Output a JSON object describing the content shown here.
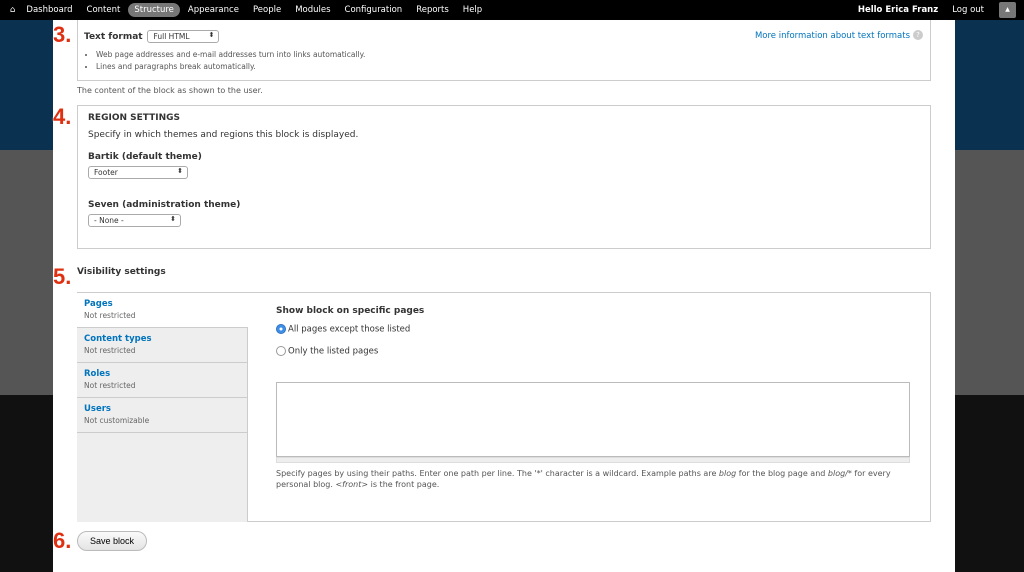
{
  "toolbar": {
    "items": [
      "Dashboard",
      "Content",
      "Structure",
      "Appearance",
      "People",
      "Modules",
      "Configuration",
      "Reports",
      "Help"
    ],
    "user": "Hello Erica Franz",
    "logout": "Log out"
  },
  "steps": [
    "3.",
    "4.",
    "5.",
    "6."
  ],
  "text_format": {
    "label": "Text format",
    "value": "Full HTML",
    "more_info": "More information about text formats",
    "tips": [
      "Web page addresses and e-mail addresses turn into links automatically.",
      "Lines and paragraphs break automatically."
    ],
    "description": "The content of the block as shown to the user."
  },
  "region": {
    "title": "REGION SETTINGS",
    "description": "Specify in which themes and regions this block is displayed.",
    "themes": [
      {
        "label": "Bartik (default theme)",
        "value": "Footer"
      },
      {
        "label": "Seven (administration theme)",
        "value": "- None -"
      }
    ]
  },
  "visibility": {
    "title": "Visibility settings",
    "tabs": [
      {
        "title": "Pages",
        "summary": "Not restricted"
      },
      {
        "title": "Content types",
        "summary": "Not restricted"
      },
      {
        "title": "Roles",
        "summary": "Not restricted"
      },
      {
        "title": "Users",
        "summary": "Not customizable"
      }
    ],
    "pane_title": "Show block on specific pages",
    "options": [
      "All pages except those listed",
      "Only the listed pages"
    ],
    "pages_value": "",
    "help_parts": [
      "Specify pages by using their paths. Enter one path per line. The '*' character is a wildcard. Example paths are ",
      "blog",
      " for the blog page and ",
      "blog/*",
      " for every personal blog. ",
      "<front>",
      " is the front page."
    ]
  },
  "save_label": "Save block"
}
